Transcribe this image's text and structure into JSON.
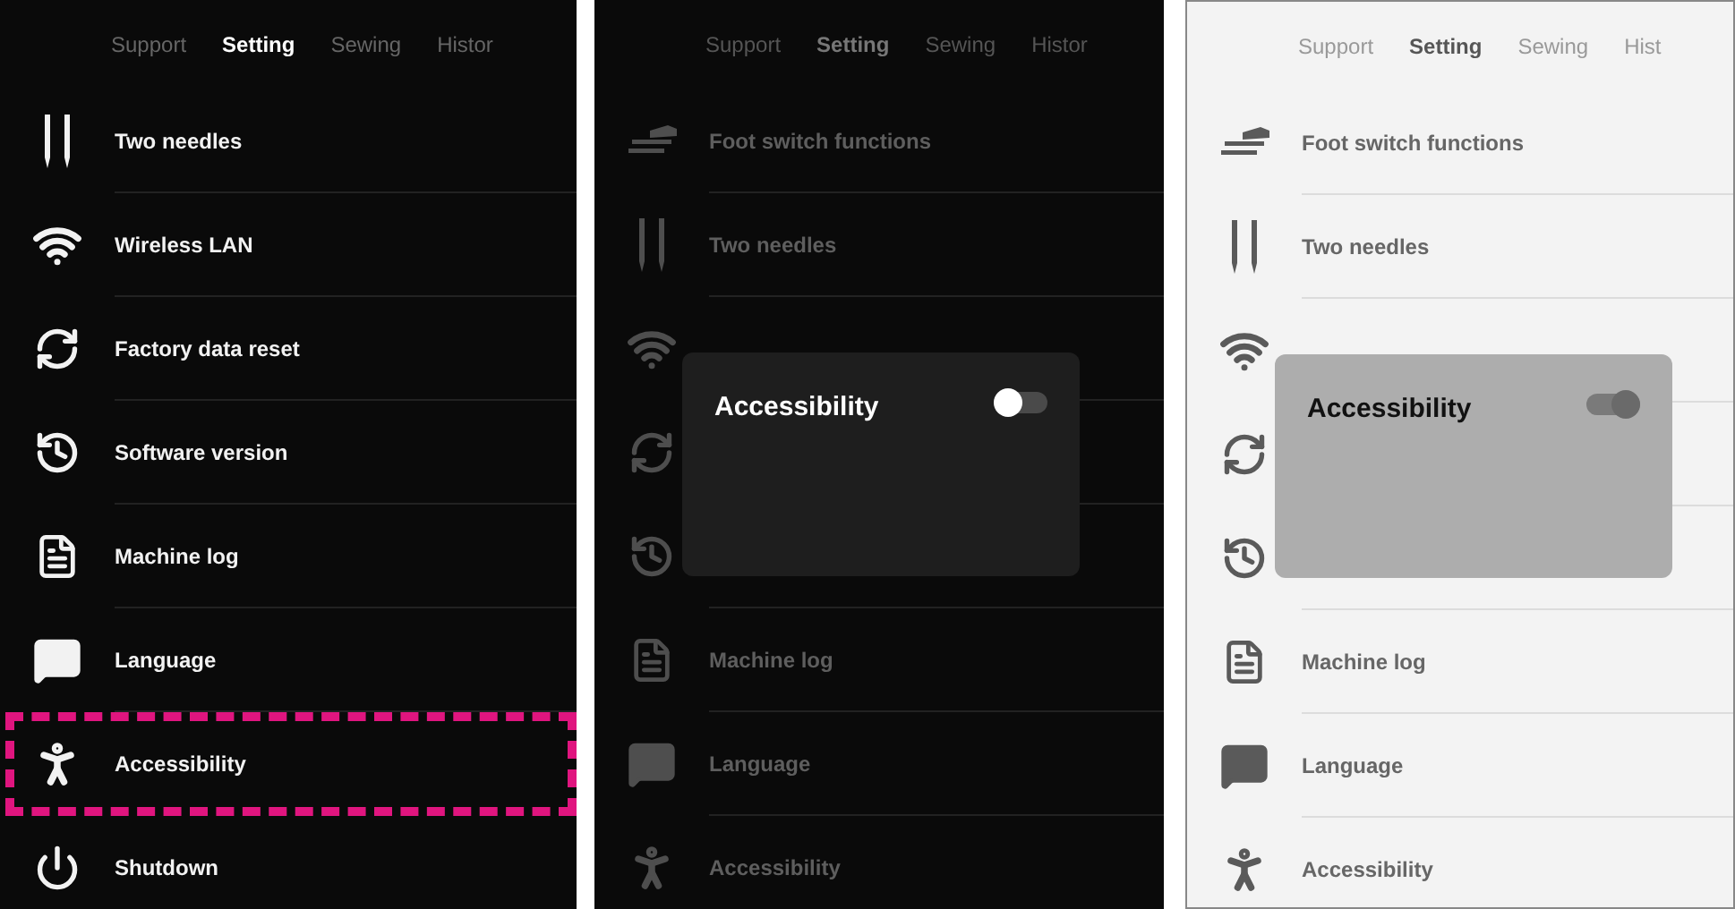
{
  "panels": [
    {
      "kind": "dark",
      "dimmed": false,
      "tabs": [
        {
          "label": "Support",
          "selected": false
        },
        {
          "label": "Setting",
          "selected": true
        },
        {
          "label": "Sewing",
          "selected": false
        },
        {
          "label": "Histor",
          "selected": false
        }
      ],
      "items": [
        {
          "kind": "needles",
          "label": "Two needles",
          "highlighted": false
        },
        {
          "kind": "wifi",
          "label": "Wireless LAN",
          "highlighted": false
        },
        {
          "kind": "reset",
          "label": "Factory data reset",
          "highlighted": false
        },
        {
          "kind": "version",
          "label": "Software version",
          "highlighted": false
        },
        {
          "kind": "log",
          "label": "Machine log",
          "highlighted": false
        },
        {
          "kind": "language",
          "label": "Language",
          "highlighted": false
        },
        {
          "kind": "accessibility",
          "label": "Accessibility",
          "highlighted": true
        },
        {
          "kind": "power",
          "label": "Shutdown",
          "highlighted": false
        }
      ]
    },
    {
      "kind": "dark",
      "dimmed": true,
      "tabs": [
        {
          "label": "Support",
          "selected": false
        },
        {
          "label": "Setting",
          "selected": true
        },
        {
          "label": "Sewing",
          "selected": false
        },
        {
          "label": "Histor",
          "selected": false
        }
      ],
      "items": [
        {
          "kind": "foot",
          "label": "Foot switch functions",
          "highlighted": false
        },
        {
          "kind": "needles",
          "label": "Two needles",
          "highlighted": false
        },
        {
          "kind": "wifi",
          "highlighted": false
        },
        {
          "kind": "reset",
          "highlighted": false
        },
        {
          "kind": "version",
          "highlighted": false
        },
        {
          "kind": "log",
          "label": "Machine log",
          "highlighted": false
        },
        {
          "kind": "language",
          "label": "Language",
          "highlighted": false
        },
        {
          "kind": "accessibility",
          "label": "Accessibility",
          "highlighted": false
        }
      ],
      "dialog": {
        "title": "Accessibility",
        "on": false
      }
    },
    {
      "kind": "light",
      "dimmed": true,
      "tabs": [
        {
          "label": "Support",
          "selected": false
        },
        {
          "label": "Setting",
          "selected": true
        },
        {
          "label": "Sewing",
          "selected": false
        },
        {
          "label": "Hist",
          "selected": false
        }
      ],
      "items": [
        {
          "kind": "foot",
          "label": "Foot switch functions",
          "highlighted": false
        },
        {
          "kind": "needles",
          "label": "Two needles",
          "highlighted": false
        },
        {
          "kind": "wifi",
          "highlighted": false
        },
        {
          "kind": "reset",
          "highlighted": false
        },
        {
          "kind": "version",
          "highlighted": false
        },
        {
          "kind": "log",
          "label": "Machine log",
          "highlighted": false
        },
        {
          "kind": "language",
          "label": "Language",
          "highlighted": false
        },
        {
          "kind": "accessibility",
          "label": "Accessibility",
          "highlighted": false
        }
      ],
      "dialog": {
        "title": "Accessibility",
        "on": true
      }
    }
  ]
}
